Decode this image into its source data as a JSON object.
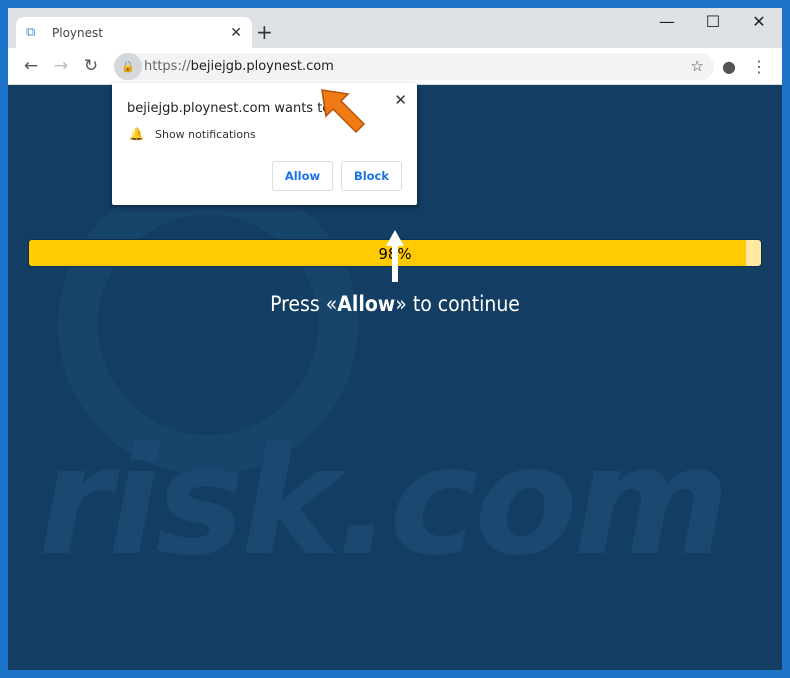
{
  "browser": {
    "tab_title": "Ploynest",
    "url_scheme": "https://",
    "url_host": "bejiejgb.ploynest.com"
  },
  "popup": {
    "title": "bejiejgb.ploynest.com wants to",
    "permission": "Show notifications",
    "allow_label": "Allow",
    "block_label": "Block"
  },
  "page": {
    "progress_text": "98%",
    "progress_percent": 98,
    "instruction_pre": "Press «",
    "instruction_bold": "Allow",
    "instruction_post": "» to continue",
    "watermark": "risk.com"
  },
  "colors": {
    "page_bg": "#133d62",
    "progress_fill": "#ffcb00",
    "window_border": "#1c73c8"
  }
}
